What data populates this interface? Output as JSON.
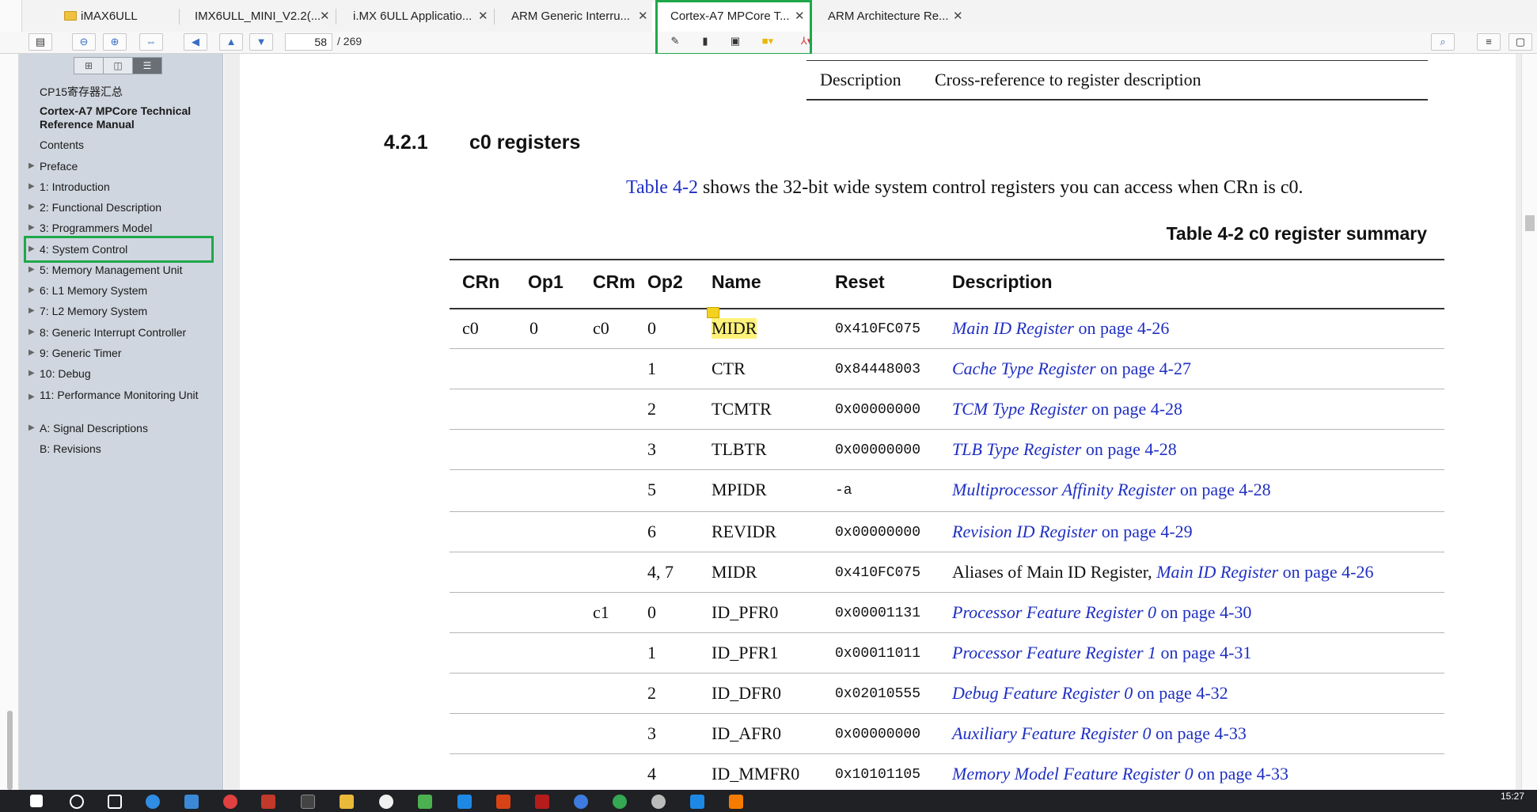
{
  "tabs": [
    {
      "label": "iMAX6ULL"
    },
    {
      "label": "IMX6ULL_MINI_V2.2(..."
    },
    {
      "label": "i.MX 6ULL Applicatio..."
    },
    {
      "label": "ARM Generic Interru..."
    },
    {
      "label": "Cortex-A7 MPCore T..."
    },
    {
      "label": "ARM Architecture Re..."
    }
  ],
  "toolbar": {
    "page_current": "58",
    "page_total": "/ 269"
  },
  "sidebar": {
    "top_item": "CP15寄存器汇总",
    "doc_title": "Cortex-A7 MPCore Technical Reference Manual",
    "items": [
      {
        "label": "Contents"
      },
      {
        "label": "Preface"
      },
      {
        "label": "1: Introduction"
      },
      {
        "label": "2: Functional Description"
      },
      {
        "label": "3: Programmers Model"
      },
      {
        "label": "4: System Control"
      },
      {
        "label": "5: Memory Management Unit"
      },
      {
        "label": "6: L1 Memory System"
      },
      {
        "label": "7: L2 Memory System"
      },
      {
        "label": "8: Generic Interrupt Controller"
      },
      {
        "label": "9: Generic Timer"
      },
      {
        "label": "10: Debug"
      },
      {
        "label": "11: Performance Monitoring Unit"
      },
      {
        "label": "A: Signal Descriptions"
      },
      {
        "label": "B: Revisions"
      }
    ]
  },
  "doc": {
    "top_row": {
      "col1": "Description",
      "col2": "Cross-reference to register description"
    },
    "section_number": "4.2.1",
    "section_title": "c0 registers",
    "intro_link": "Table 4-2",
    "intro_text": " shows the 32-bit wide system control registers you can access when CRn is c0.",
    "table_caption": "Table 4-2 c0 register summary",
    "headers": [
      "CRn",
      "Op1",
      "CRm",
      "Op2",
      "Name",
      "Reset",
      "Description"
    ],
    "rows": [
      {
        "crn": "c0",
        "op1": "0",
        "crm": "c0",
        "op2": "0",
        "name": "MIDR",
        "reset": "0x410FC075",
        "prefix": "",
        "link": "Main ID Register",
        "page": " on page 4-26"
      },
      {
        "crn": "",
        "op1": "",
        "crm": "",
        "op2": "1",
        "name": "CTR",
        "reset": "0x84448003",
        "prefix": "",
        "link": "Cache Type Register",
        "page": " on page 4-27"
      },
      {
        "crn": "",
        "op1": "",
        "crm": "",
        "op2": "2",
        "name": "TCMTR",
        "reset": "0x00000000",
        "prefix": "",
        "link": "TCM Type Register",
        "page": " on page 4-28"
      },
      {
        "crn": "",
        "op1": "",
        "crm": "",
        "op2": "3",
        "name": "TLBTR",
        "reset": "0x00000000",
        "prefix": "",
        "link": "TLB Type Register",
        "page": " on page 4-28"
      },
      {
        "crn": "",
        "op1": "",
        "crm": "",
        "op2": "5",
        "name": "MPIDR",
        "reset": "-a",
        "prefix": "",
        "link": "Multiprocessor Affinity Register",
        "page": " on page 4-28"
      },
      {
        "crn": "",
        "op1": "",
        "crm": "",
        "op2": "6",
        "name": "REVIDR",
        "reset": "0x00000000",
        "prefix": "",
        "link": "Revision ID Register",
        "page": " on page 4-29"
      },
      {
        "crn": "",
        "op1": "",
        "crm": "",
        "op2": "4, 7",
        "name": "MIDR",
        "reset": "0x410FC075",
        "prefix": "Aliases of Main ID Register, ",
        "link": "Main ID Register",
        "page": " on page 4-26"
      },
      {
        "crn": "",
        "op1": "",
        "crm": "c1",
        "op2": "0",
        "name": "ID_PFR0",
        "reset": "0x00001131",
        "prefix": "",
        "link": "Processor Feature Register 0",
        "page": " on page 4-30"
      },
      {
        "crn": "",
        "op1": "",
        "crm": "",
        "op2": "1",
        "name": "ID_PFR1",
        "reset": "0x00011011",
        "prefix": "",
        "link": "Processor Feature Register 1",
        "page": " on page 4-31"
      },
      {
        "crn": "",
        "op1": "",
        "crm": "",
        "op2": "2",
        "name": "ID_DFR0",
        "reset": "0x02010555",
        "prefix": "",
        "link": "Debug Feature Register 0",
        "page": " on page 4-32"
      },
      {
        "crn": "",
        "op1": "",
        "crm": "",
        "op2": "3",
        "name": "ID_AFR0",
        "reset": "0x00000000",
        "prefix": "",
        "link": "Auxiliary Feature Register 0",
        "page": " on page 4-33"
      },
      {
        "crn": "",
        "op1": "",
        "crm": "",
        "op2": "4",
        "name": "ID_MMFR0",
        "reset": "0x10101105",
        "prefix": "",
        "link": "Memory Model Feature Register 0",
        "page": " on page 4-33"
      }
    ]
  },
  "taskbar": {
    "time": "15:27"
  },
  "colors": {
    "highlight_box": "#1fa84a",
    "link": "#1f2fc2",
    "sidebar_bg": "#cfd6df"
  }
}
